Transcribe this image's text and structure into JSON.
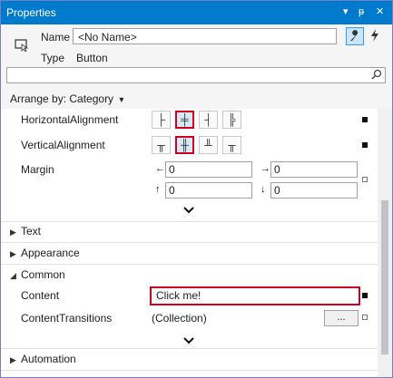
{
  "window": {
    "title": "Properties",
    "controls": {
      "dropdown": "▾",
      "pin": "ᵽ",
      "close": "✕"
    }
  },
  "header": {
    "name_label": "Name",
    "name_value": "<No Name>",
    "type_label": "Type",
    "type_value": "Button",
    "icons": {
      "element": "element-icon",
      "properties": "wrench-icon",
      "events": "lightning-icon"
    }
  },
  "search": {
    "placeholder": "",
    "icon": "search-icon"
  },
  "arrange": {
    "label": "Arrange by: Category",
    "arrow": "▾"
  },
  "layout": {
    "horizontal_label": "HorizontalAlignment",
    "horizontal_options": [
      "├",
      "╪",
      "┤",
      "╠"
    ],
    "horizontal_selected": 1,
    "vertical_label": "VerticalAlignment",
    "vertical_options": [
      "╥",
      "╫",
      "╨",
      "╥"
    ],
    "vertical_selected": 1,
    "margin_label": "Margin",
    "margin": {
      "left": "0",
      "right": "0",
      "top": "0",
      "bottom": "0"
    },
    "margin_arrows": {
      "left": "←",
      "right": "→",
      "up": "↑",
      "down": "↓"
    },
    "expander": "⌄"
  },
  "categories": {
    "text": "Text",
    "appearance": "Appearance",
    "common": "Common",
    "automation": "Automation",
    "collapsed_tri": "▶",
    "expanded_tri": "◢"
  },
  "common": {
    "content_label": "Content",
    "content_value": "Click me!",
    "transitions_label": "ContentTransitions",
    "transitions_value": "(Collection)",
    "ellipsis": "...",
    "expander": "⌄"
  },
  "colors": {
    "title_bg": "#007acc",
    "highlight": "#d1001c",
    "selected_fill": "#d6e7f5"
  }
}
